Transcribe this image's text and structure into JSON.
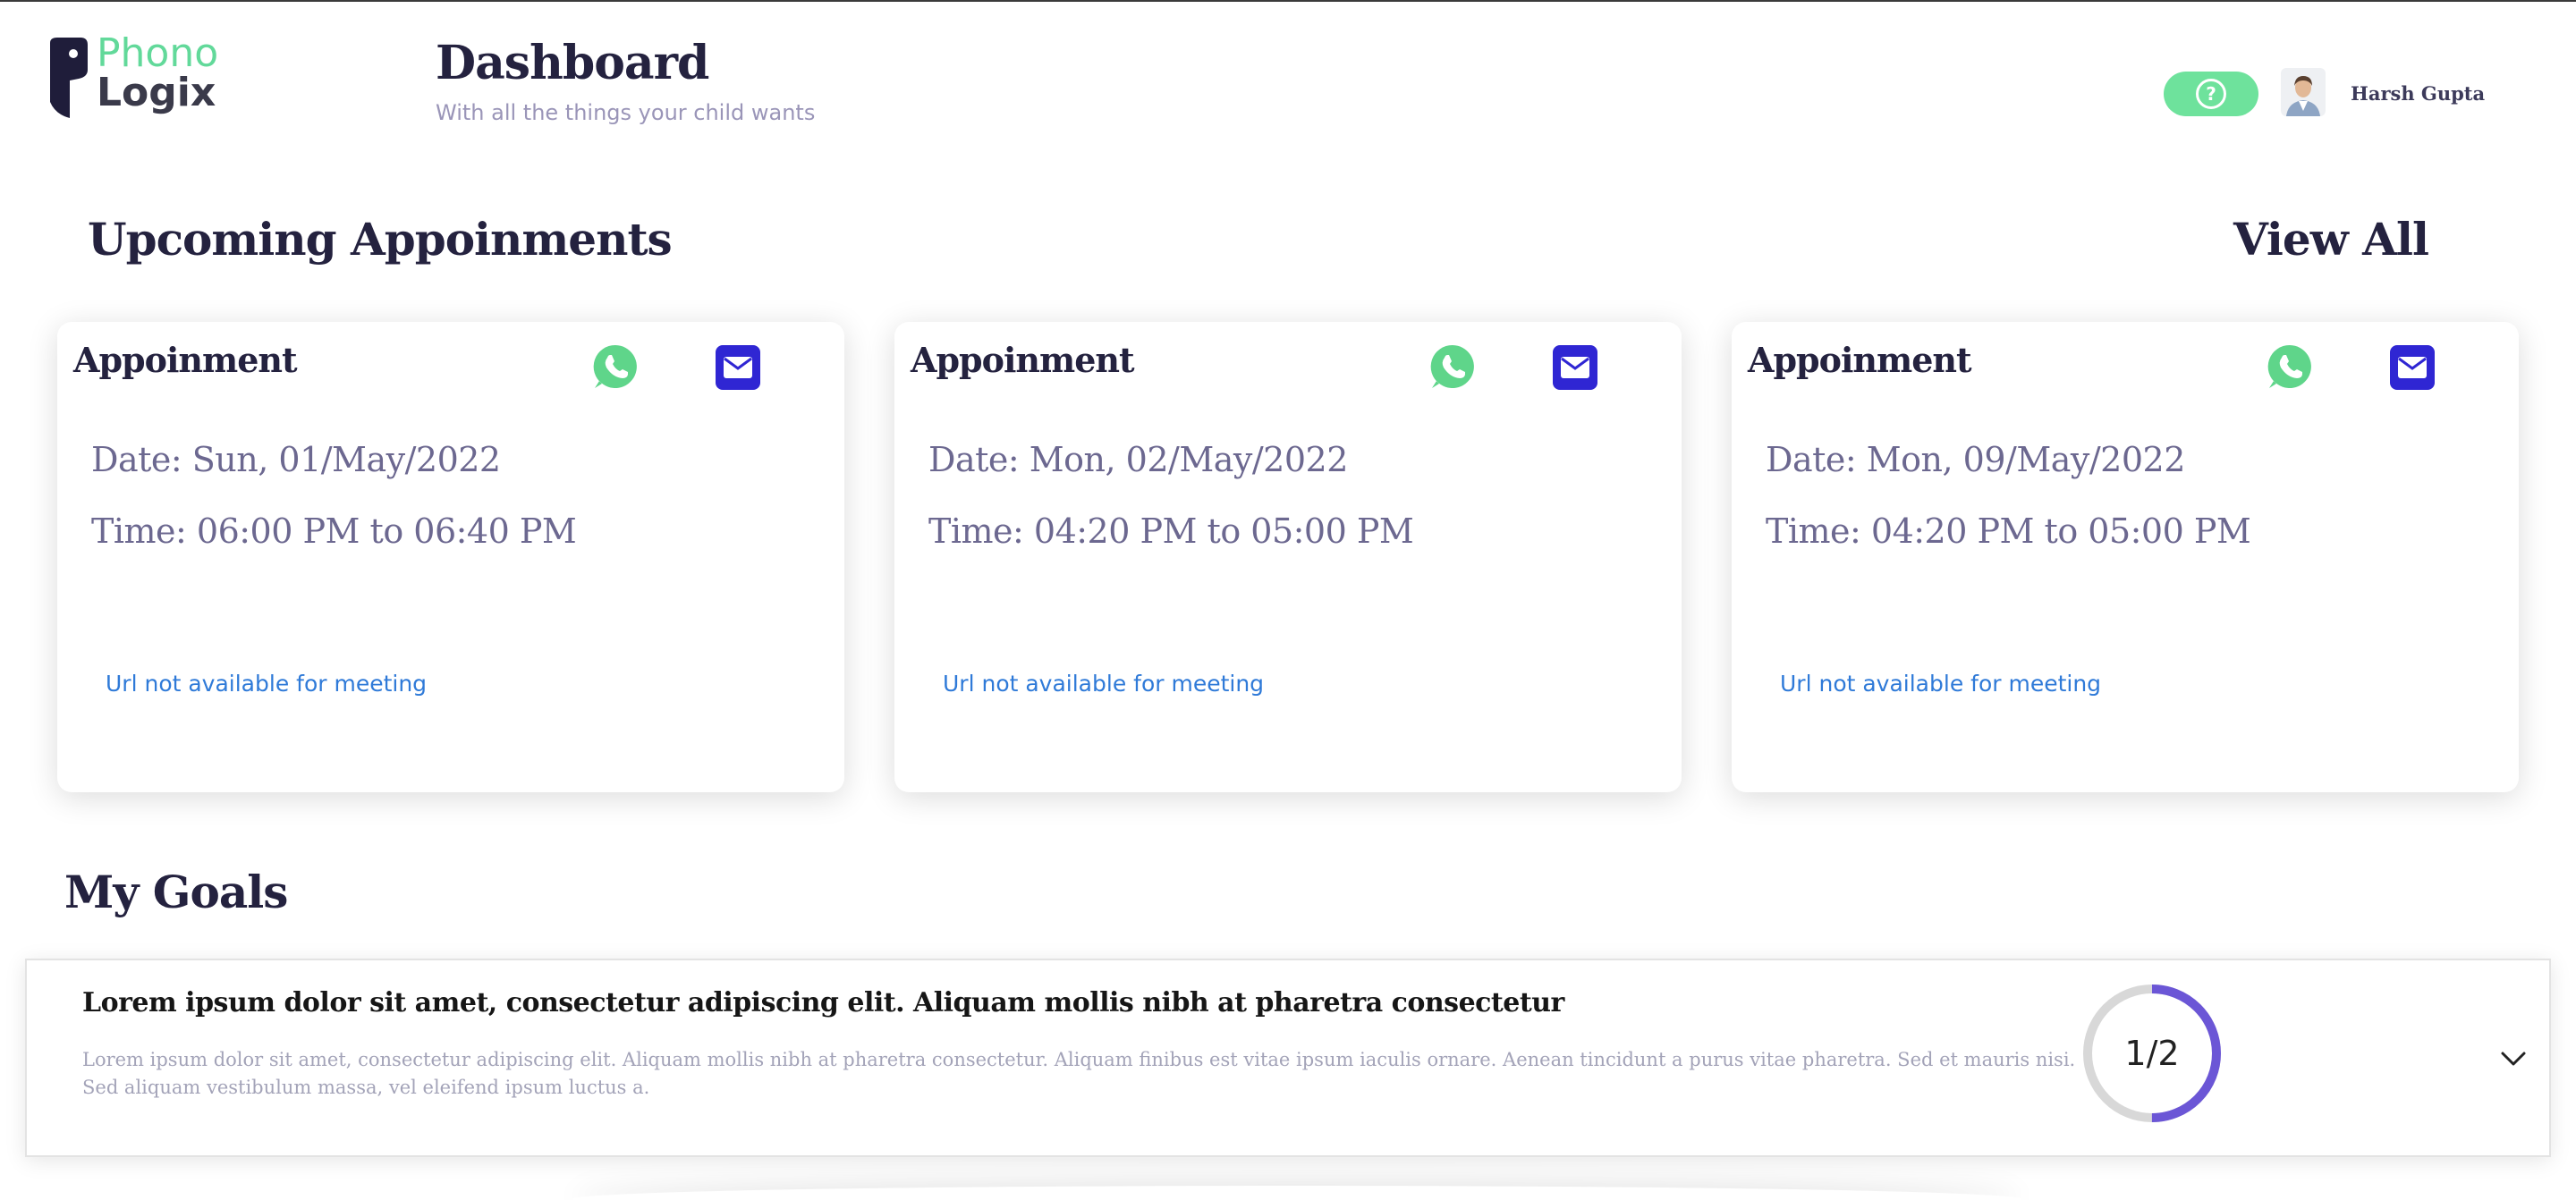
{
  "brand": {
    "word1": "Phono",
    "word2": "Logix",
    "accent_color": "#62d99a",
    "mark_color": "#1f1d3a"
  },
  "header": {
    "title": "Dashboard",
    "subtitle": "With all the things your child wants",
    "help_icon": "question-circle-icon",
    "help_glyph": "?",
    "user_name": "Harsh Gupta"
  },
  "appointments": {
    "section_title": "Upcoming Appoinments",
    "view_all_label": "View All",
    "items": [
      {
        "title": "Appoinment",
        "date": "Date: Sun, 01/May/2022",
        "time": "Time: 06:00 PM to 06:40 PM",
        "url_text": "Url not available for meeting"
      },
      {
        "title": "Appoinment",
        "date": "Date: Mon, 02/May/2022",
        "time": "Time: 04:20 PM to 05:00 PM",
        "url_text": "Url not available for meeting"
      },
      {
        "title": "Appoinment",
        "date": "Date: Mon, 09/May/2022",
        "time": "Time: 04:20 PM to 05:00 PM",
        "url_text": "Url not available for meeting"
      }
    ],
    "whatsapp_color": "#5fd58a",
    "mail_color": "#2f26d3"
  },
  "goals": {
    "section_title": "My Goals",
    "items": [
      {
        "title": "Lorem ipsum dolor sit amet, consectetur adipiscing elit. Aliquam mollis nibh at pharetra consectetur",
        "description": "Lorem ipsum dolor sit amet, consectetur adipiscing elit. Aliquam mollis nibh at pharetra consectetur. Aliquam finibus est vitae ipsum iaculis ornare. Aenean tincidunt a purus vitae pharetra. Sed et mauris nisi. Sed aliquam vestibulum massa, vel eleifend ipsum luctus a.",
        "progress_label": "1/2",
        "progress_fraction": 0.5,
        "progress_color": "#6b56d6",
        "track_color": "#d8d8d8"
      }
    ]
  }
}
